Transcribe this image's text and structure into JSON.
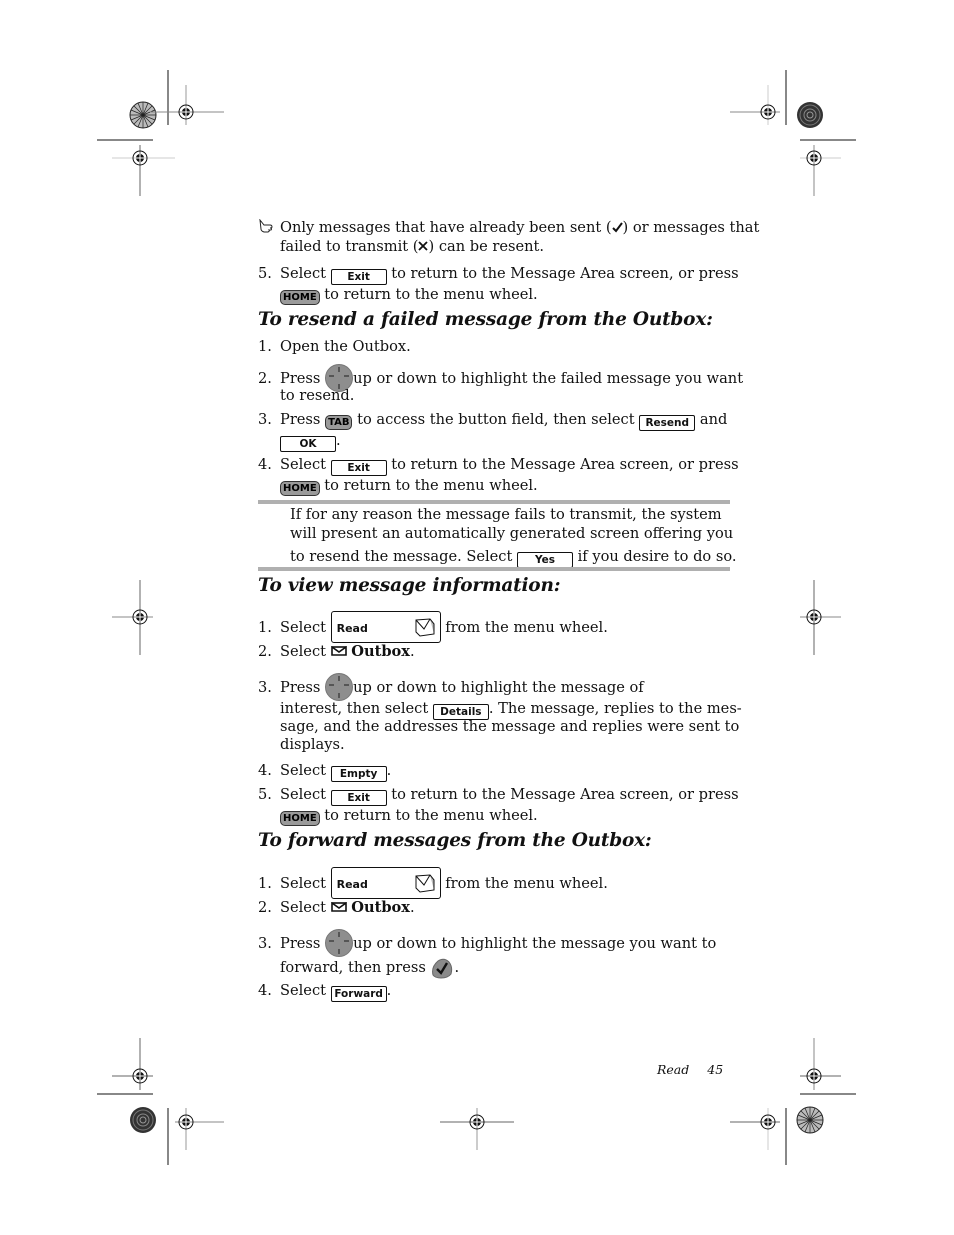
{
  "note_tip": {
    "icon": "pointing-hand-icon",
    "line1_a": "Only messages that have already been sent (",
    "line1_b": ") or messages that",
    "line2_a": "failed to transmit (",
    "line2_b": ") can be resent.",
    "sent_icon": "check-icon",
    "failed_icon": "x-icon"
  },
  "step5_top": {
    "num": "5.",
    "a": "Select",
    "button": "Exit",
    "b": "to return to the Message Area screen, or press",
    "key": "HOME",
    "c": "to return to the menu wheel."
  },
  "section_resend": {
    "heading": "To resend a failed message from the Outbox:",
    "steps": [
      {
        "num": "1.",
        "text": "Open the Outbox."
      },
      {
        "num": "2.",
        "a": "Press",
        "b": "up or down to highlight the failed message you want",
        "c": "to resend."
      },
      {
        "num": "3.",
        "a": "Press",
        "key": "TAB",
        "b": "to access the button field, then select",
        "button1": "Resend",
        "c": "and",
        "button2": "OK",
        "d": "."
      },
      {
        "num": "4.",
        "a": "Select",
        "button": "Exit",
        "b": "to return to the Message Area screen, or press",
        "key": "HOME",
        "c": "to return to the menu wheel."
      }
    ],
    "note": {
      "line1": "If for any reason the message fails to transmit, the system",
      "line2": "will present an automatically generated screen offering you",
      "line3_a": "to resend the message. Select",
      "button": "Yes",
      "line3_b": "if you desire to do so."
    }
  },
  "section_view": {
    "heading": "To view message information:",
    "steps": [
      {
        "num": "1.",
        "a": "Select",
        "menu_button": "Read",
        "b": "from the menu wheel."
      },
      {
        "num": "2.",
        "a": "Select",
        "bold": "Outbox",
        "b": "."
      },
      {
        "num": "3.",
        "a": "Press",
        "b": "up or down to highlight the message of",
        "c": "interest, then select",
        "button": "Details",
        "d": ". The message, replies to the mes-",
        "e": "sage, and the addresses the message and replies were sent to",
        "f": "displays."
      },
      {
        "num": "4.",
        "a": "Select",
        "button": "Empty",
        "b": "."
      },
      {
        "num": "5.",
        "a": "Select",
        "button": "Exit",
        "b": "to return to the Message Area screen, or press",
        "key": "HOME",
        "c": "to return to the menu wheel."
      }
    ]
  },
  "section_forward": {
    "heading": "To forward messages from the Outbox:",
    "steps": [
      {
        "num": "1.",
        "a": "Select",
        "menu_button": "Read",
        "b": "from the menu wheel."
      },
      {
        "num": "2.",
        "a": "Select",
        "bold": "Outbox",
        "b": "."
      },
      {
        "num": "3.",
        "a": "Press",
        "b": "up or down to highlight the message you want to",
        "c": "forward, then press",
        "d": "."
      },
      {
        "num": "4.",
        "a": "Select",
        "button": "Forward",
        "b": "."
      }
    ]
  },
  "footer": {
    "section": "Read",
    "page": "45"
  }
}
